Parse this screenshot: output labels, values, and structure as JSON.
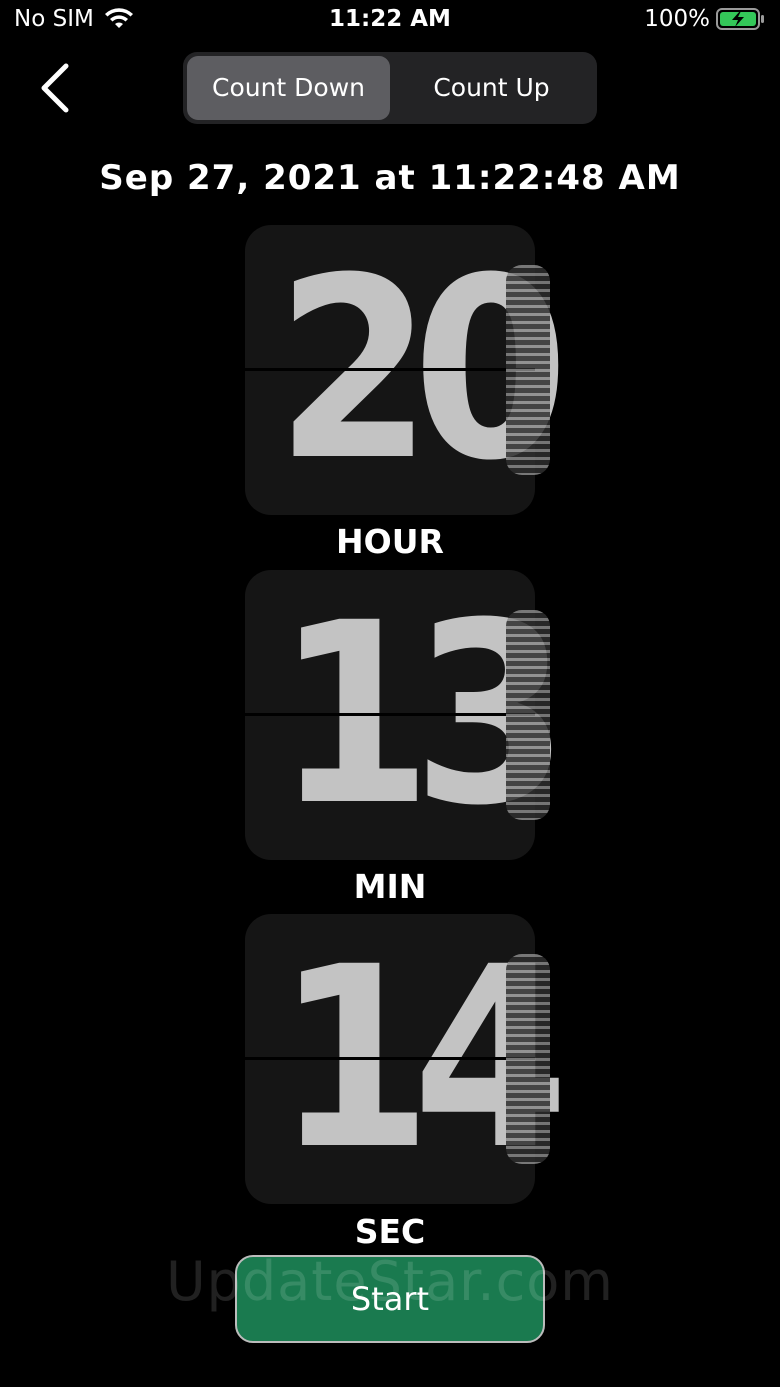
{
  "status_bar": {
    "carrier": "No SIM",
    "time": "11:22 AM",
    "battery": "100%",
    "battery_color": "#34c759"
  },
  "nav": {
    "back_icon": "chevron-left-icon",
    "segments": [
      {
        "label": "Count Down",
        "selected": true
      },
      {
        "label": "Count Up",
        "selected": false
      }
    ]
  },
  "date_label": "Sep 27, 2021 at 11:22:48 AM",
  "cards": [
    {
      "value": "20",
      "unit": "HOUR"
    },
    {
      "value": "13",
      "unit": "MIN"
    },
    {
      "value": "14",
      "unit": "SEC"
    }
  ],
  "start_button": {
    "label": "Start",
    "color": "#1a7a4f"
  },
  "watermark": "UpdateStar.com"
}
